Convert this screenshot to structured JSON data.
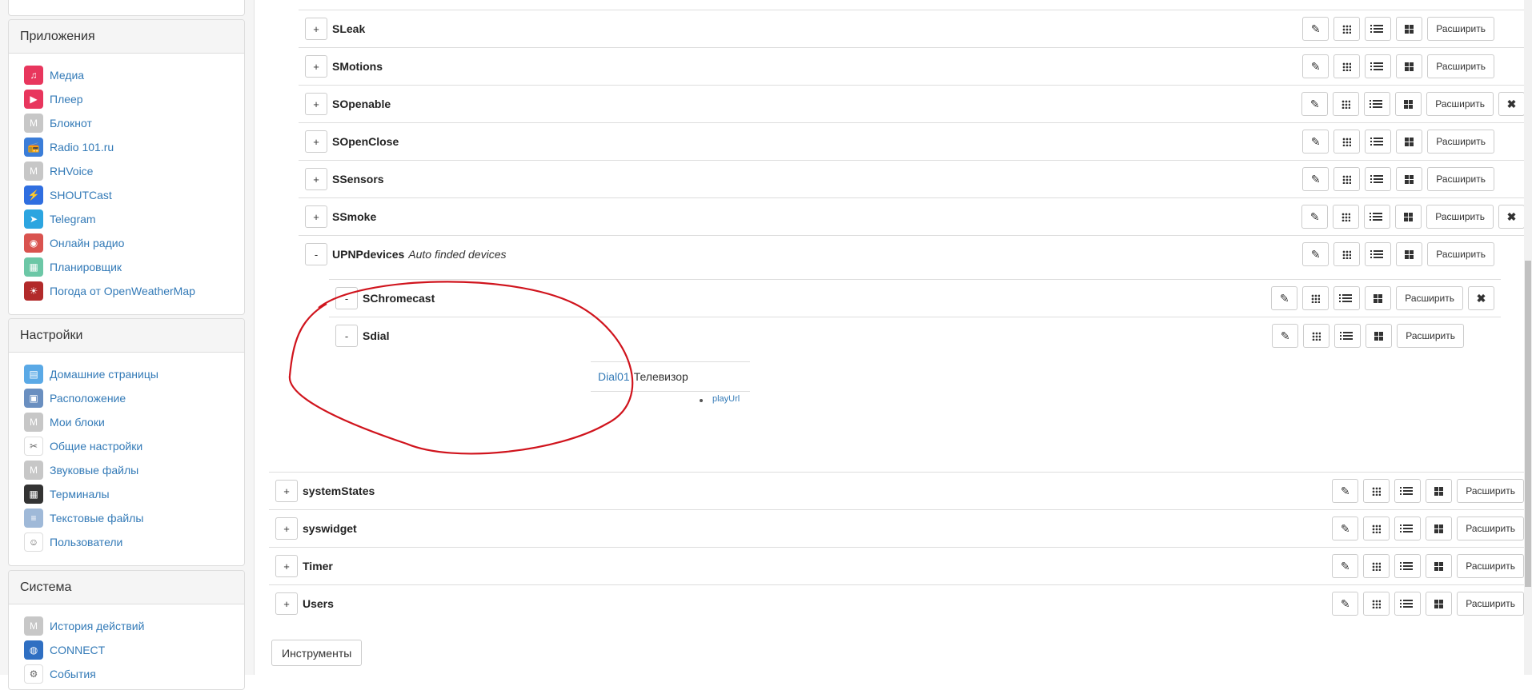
{
  "sidebar": {
    "apps": {
      "title": "Приложения",
      "items": [
        {
          "label": "Медиа",
          "icon": "music-icon",
          "color": "#e8365d",
          "glyph": "♫"
        },
        {
          "label": "Плеер",
          "icon": "play-icon",
          "color": "#e8365d",
          "glyph": "▶"
        },
        {
          "label": "Блокнот",
          "icon": "module-icon",
          "color": "#c7c7c7",
          "glyph": "M"
        },
        {
          "label": "Radio 101.ru",
          "icon": "radio-icon",
          "color": "#3b7dd8",
          "glyph": "📻"
        },
        {
          "label": "RHVoice",
          "icon": "module-icon",
          "color": "#c7c7c7",
          "glyph": "M"
        },
        {
          "label": "SHOUTCast",
          "icon": "lightning-icon",
          "color": "#2f6ee0",
          "glyph": "⚡"
        },
        {
          "label": "Telegram",
          "icon": "telegram-icon",
          "color": "#2ca5e0",
          "glyph": "➤"
        },
        {
          "label": "Онлайн радио",
          "icon": "radio-icon",
          "color": "#d9534f",
          "glyph": "◉"
        },
        {
          "label": "Планировщик",
          "icon": "calendar-icon",
          "color": "#6cc7a6",
          "glyph": "▦"
        },
        {
          "label": "Погода от OpenWeatherMap",
          "icon": "sun-icon",
          "color": "#b22a2a",
          "glyph": "☀"
        }
      ]
    },
    "settings": {
      "title": "Настройки",
      "items": [
        {
          "label": "Домашние страницы",
          "icon": "document-icon",
          "color": "#5aa9e6",
          "glyph": "▤"
        },
        {
          "label": "Расположение",
          "icon": "folder-icon",
          "color": "#6a8fc0",
          "glyph": "▣"
        },
        {
          "label": "Мои блоки",
          "icon": "module-icon",
          "color": "#c7c7c7",
          "glyph": "M"
        },
        {
          "label": "Общие настройки",
          "icon": "tools-icon",
          "color": "#ffffff",
          "glyph": "✂"
        },
        {
          "label": "Звуковые файлы",
          "icon": "module-icon",
          "color": "#c7c7c7",
          "glyph": "M"
        },
        {
          "label": "Терминалы",
          "icon": "terminal-icon",
          "color": "#333333",
          "glyph": "▦"
        },
        {
          "label": "Текстовые файлы",
          "icon": "text-file-icon",
          "color": "#9fb9d8",
          "glyph": "≡"
        },
        {
          "label": "Пользователи",
          "icon": "users-icon",
          "color": "#ffffff",
          "glyph": "☺"
        }
      ]
    },
    "system": {
      "title": "Система",
      "items": [
        {
          "label": "История действий",
          "icon": "module-icon",
          "color": "#c7c7c7",
          "glyph": "M"
        },
        {
          "label": "CONNECT",
          "icon": "globe-icon",
          "color": "#2f6fc2",
          "glyph": "◍"
        },
        {
          "label": "События",
          "icon": "event-icon",
          "color": "#ffffff",
          "glyph": "⚙"
        }
      ]
    }
  },
  "rows": [
    {
      "name": "SLeak",
      "desc": "",
      "toggle": "+",
      "close": false
    },
    {
      "name": "SMotions",
      "desc": "",
      "toggle": "+",
      "close": false
    },
    {
      "name": "SOpenable",
      "desc": "",
      "toggle": "+",
      "close": true
    },
    {
      "name": "SOpenClose",
      "desc": "",
      "toggle": "+",
      "close": false
    },
    {
      "name": "SSensors",
      "desc": "",
      "toggle": "+",
      "close": false
    },
    {
      "name": "SSmoke",
      "desc": "",
      "toggle": "+",
      "close": true
    },
    {
      "name": "UPNPdevices",
      "desc": "Auto finded devices",
      "toggle": "-",
      "close": false
    },
    {
      "name": "SChromecast",
      "desc": "",
      "toggle": "-",
      "close": true
    },
    {
      "name": "Sdial",
      "desc": "",
      "toggle": "-",
      "close": false
    },
    {
      "name": "systemStates",
      "desc": "",
      "toggle": "+",
      "close": false
    },
    {
      "name": "syswidget",
      "desc": "",
      "toggle": "+",
      "close": false
    },
    {
      "name": "Timer",
      "desc": "",
      "toggle": "+",
      "close": false
    },
    {
      "name": "Users",
      "desc": "",
      "toggle": "+",
      "close": false
    }
  ],
  "buttons": {
    "expand_label": "Расширить",
    "close_glyph": "✖",
    "edit_glyph": "✎"
  },
  "device": {
    "link": "Dial01",
    "title": "Телевизор",
    "property": "playUrl"
  },
  "tools_button": "Инструменты",
  "colors": {
    "link": "#337ab7",
    "annotation": "#d0141d"
  }
}
